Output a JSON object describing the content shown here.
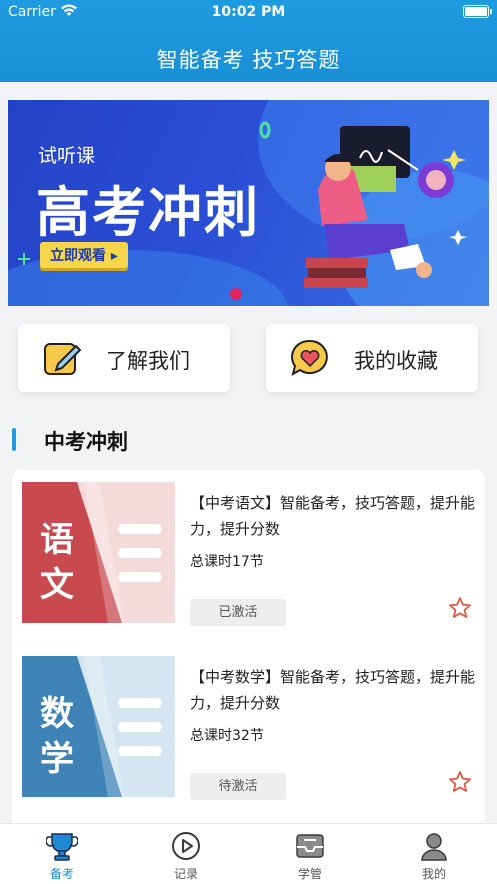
{
  "status_bar": {
    "carrier": "Carrier",
    "time": "10:02 PM"
  },
  "nav": {
    "title": "智能备考 技巧答题"
  },
  "banner": {
    "label": "试听课",
    "title": "高考冲刺",
    "button": "立即观看 ▸"
  },
  "quick_links": [
    {
      "label": "了解我们",
      "icon": "pencil-note-icon"
    },
    {
      "label": "我的收藏",
      "icon": "heart-bubble-icon"
    }
  ],
  "section": {
    "title": "中考冲刺"
  },
  "courses": [
    {
      "cover_text": [
        "语",
        "文"
      ],
      "description": "【中考语文】智能备考，技巧答题，提升能力，提升分数",
      "hours": "总课时17节",
      "status": "已激活",
      "colors": {
        "strip": "#c8494e",
        "bg": "#f5dadb",
        "lines": "#ffffff"
      }
    },
    {
      "cover_text": [
        "数",
        "学"
      ],
      "description": "【中考数学】智能备考，技巧答题，提升能力，提升分数",
      "hours": "总课时32节",
      "status": "待激活",
      "colors": {
        "strip": "#3e82b6",
        "bg": "#d3e6f1",
        "lines": "#ffffff"
      }
    }
  ],
  "tabbar": [
    {
      "label": "备考",
      "icon": "trophy-icon",
      "active": true
    },
    {
      "label": "记录",
      "icon": "play-circle-icon",
      "active": false
    },
    {
      "label": "学管",
      "icon": "inbox-icon",
      "active": false
    },
    {
      "label": "我的",
      "icon": "user-icon",
      "active": false
    }
  ],
  "colors": {
    "accent": "#1e9be0",
    "star": "#e05a4a",
    "active_tab": "#1e8ad6"
  }
}
